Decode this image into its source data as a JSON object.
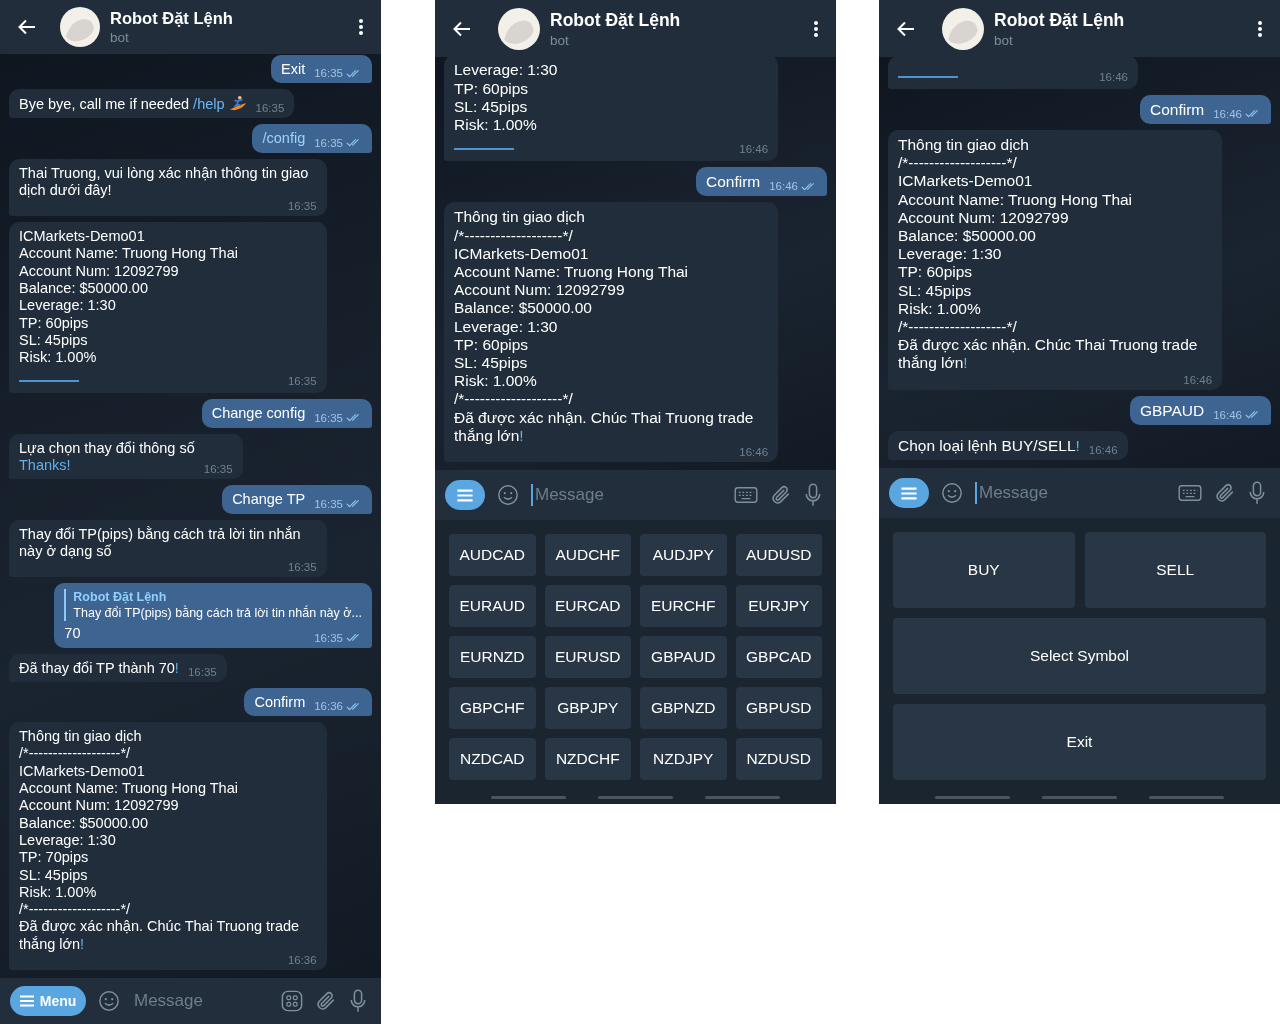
{
  "panels": [
    {
      "header": {
        "title": "Robot Đặt Lệnh",
        "subtitle": "bot"
      },
      "messages": [
        {
          "kind": "out",
          "parts": [
            {
              "text": "Exit"
            }
          ],
          "time": "16:35",
          "read": true
        },
        {
          "kind": "in",
          "parts": [
            {
              "text": "Bye bye, call me if needed "
            },
            {
              "text": "/help",
              "kind": "link"
            }
          ],
          "emoji": true,
          "time": "16:35"
        },
        {
          "kind": "out",
          "parts": [
            {
              "text": "/config",
              "kind": "link"
            }
          ],
          "time": "16:35",
          "read": true
        },
        {
          "kind": "in",
          "parts": [
            {
              "text": "Thai Truong, vui lòng xác nhận thông tin giao dịch dưới đây!"
            }
          ],
          "time": "16:35"
        },
        {
          "kind": "in",
          "parts": [
            {
              "text": "ICMarkets-Demo01\nAccount Name: Truong Hong Thai\nAccount Num: 12092799\nBalance: $50000.00\nLeverage: 1:30\nTP: 60pips\nSL: 45pips\nRisk: 1.00%"
            }
          ],
          "bar": true,
          "time": "16:35"
        },
        {
          "kind": "out",
          "parts": [
            {
              "text": "Change config"
            }
          ],
          "time": "16:35",
          "read": true
        },
        {
          "kind": "in",
          "parts": [
            {
              "text": "Lựa chọn thay đổi thông số\n"
            },
            {
              "text": "Thanks!",
              "kind": "accent"
            }
          ],
          "time": "16:35"
        },
        {
          "kind": "out",
          "parts": [
            {
              "text": "Change TP"
            }
          ],
          "time": "16:35",
          "read": true
        },
        {
          "kind": "in",
          "parts": [
            {
              "text": "Thay đổi TP(pips) bằng cách trả lời tin nhắn này ở dạng số"
            }
          ],
          "time": "16:35"
        },
        {
          "kind": "out",
          "reply": {
            "author": "Robot Đặt Lệnh",
            "text": "Thay đổi TP(pips) bằng cách trả lời tin nhắn này ở..."
          },
          "parts": [
            {
              "text": "70"
            }
          ],
          "time": "16:35",
          "read": true
        },
        {
          "kind": "in",
          "parts": [
            {
              "text": "Đã thay đổi TP thành 70"
            },
            {
              "text": "!",
              "kind": "accent"
            }
          ],
          "time": "16:35"
        },
        {
          "kind": "out",
          "parts": [
            {
              "text": "Confirm"
            }
          ],
          "time": "16:36",
          "read": true
        },
        {
          "kind": "in",
          "parts": [
            {
              "text": "Thông tin giao dịch\n/*-------------------*/\nICMarkets-Demo01\nAccount Name: Truong Hong Thai\nAccount Num: 12092799\nBalance: $50000.00\nLeverage: 1:30\nTP: 70pips\nSL: 45pips\nRisk: 1.00%\n/*-------------------*/\nĐã được xác nhận. Chúc Thai Truong trade thắng lớn"
            },
            {
              "text": "!",
              "kind": "accent"
            }
          ],
          "time": "16:36"
        }
      ],
      "composer": {
        "menu_label": "Menu",
        "placeholder": "Message",
        "focused": false,
        "keyboard_shown": false
      }
    },
    {
      "header": {
        "title": "Robot Đặt Lệnh",
        "subtitle": "bot"
      },
      "messages": [
        {
          "kind": "in",
          "parts": [
            {
              "text": "Leverage: 1:30\nTP: 60pips\nSL: 45pips\nRisk: 1.00%"
            }
          ],
          "bar": true,
          "time": "16:46"
        },
        {
          "kind": "out",
          "parts": [
            {
              "text": "Confirm"
            }
          ],
          "time": "16:46",
          "read": true
        },
        {
          "kind": "in",
          "parts": [
            {
              "text": "Thông tin giao dịch\n/*-------------------*/\nICMarkets-Demo01\nAccount Name: Truong Hong Thai\nAccount Num: 12092799\nBalance: $50000.00\nLeverage: 1:30\nTP: 60pips\nSL: 45pips\nRisk: 1.00%\n/*-------------------*/\nĐã được xác nhận. Chúc Thai Truong trade thắng lớn"
            },
            {
              "text": "!",
              "kind": "accent"
            }
          ],
          "time": "16:46"
        }
      ],
      "composer": {
        "placeholder": "Message",
        "focused": true,
        "keyboard_shown": true
      },
      "keyboard": {
        "kind": "grid",
        "rows": [
          [
            "AUDCAD",
            "AUDCHF",
            "AUDJPY",
            "AUDUSD"
          ],
          [
            "EURAUD",
            "EURCAD",
            "EURCHF",
            "EURJPY"
          ],
          [
            "EURNZD",
            "EURUSD",
            "GBPAUD",
            "GBPCAD"
          ],
          [
            "GBPCHF",
            "GBPJPY",
            "GBPNZD",
            "GBPUSD"
          ],
          [
            "NZDCAD",
            "NZDCHF",
            "NZDJPY",
            "NZDUSD"
          ]
        ]
      }
    },
    {
      "header": {
        "title": "Robot Đặt Lệnh",
        "subtitle": "bot"
      },
      "messages": [
        {
          "kind": "in",
          "bar": true,
          "time": "16:46"
        },
        {
          "kind": "out",
          "parts": [
            {
              "text": "Confirm"
            }
          ],
          "time": "16:46",
          "read": true
        },
        {
          "kind": "in",
          "parts": [
            {
              "text": "Thông tin giao dịch\n/*-------------------*/\nICMarkets-Demo01\nAccount Name: Truong Hong Thai\nAccount Num: 12092799\nBalance: $50000.00\nLeverage: 1:30\nTP: 60pips\nSL: 45pips\nRisk: 1.00%\n/*-------------------*/\nĐã được xác nhận. Chúc Thai Truong trade thắng lớn"
            },
            {
              "text": "!",
              "kind": "accent"
            }
          ],
          "time": "16:46"
        },
        {
          "kind": "out",
          "parts": [
            {
              "text": "GBPAUD"
            }
          ],
          "time": "16:46",
          "read": true
        },
        {
          "kind": "in",
          "parts": [
            {
              "text": "Chọn loại lệnh BUY/SELL"
            },
            {
              "text": "!",
              "kind": "accent"
            }
          ],
          "time": "16:46"
        }
      ],
      "composer": {
        "placeholder": "Message",
        "focused": true,
        "keyboard_shown": true
      },
      "keyboard": {
        "kind": "large",
        "rows": [
          [
            "BUY",
            "SELL"
          ],
          [
            "Select Symbol"
          ],
          [
            "Exit"
          ]
        ]
      }
    }
  ]
}
